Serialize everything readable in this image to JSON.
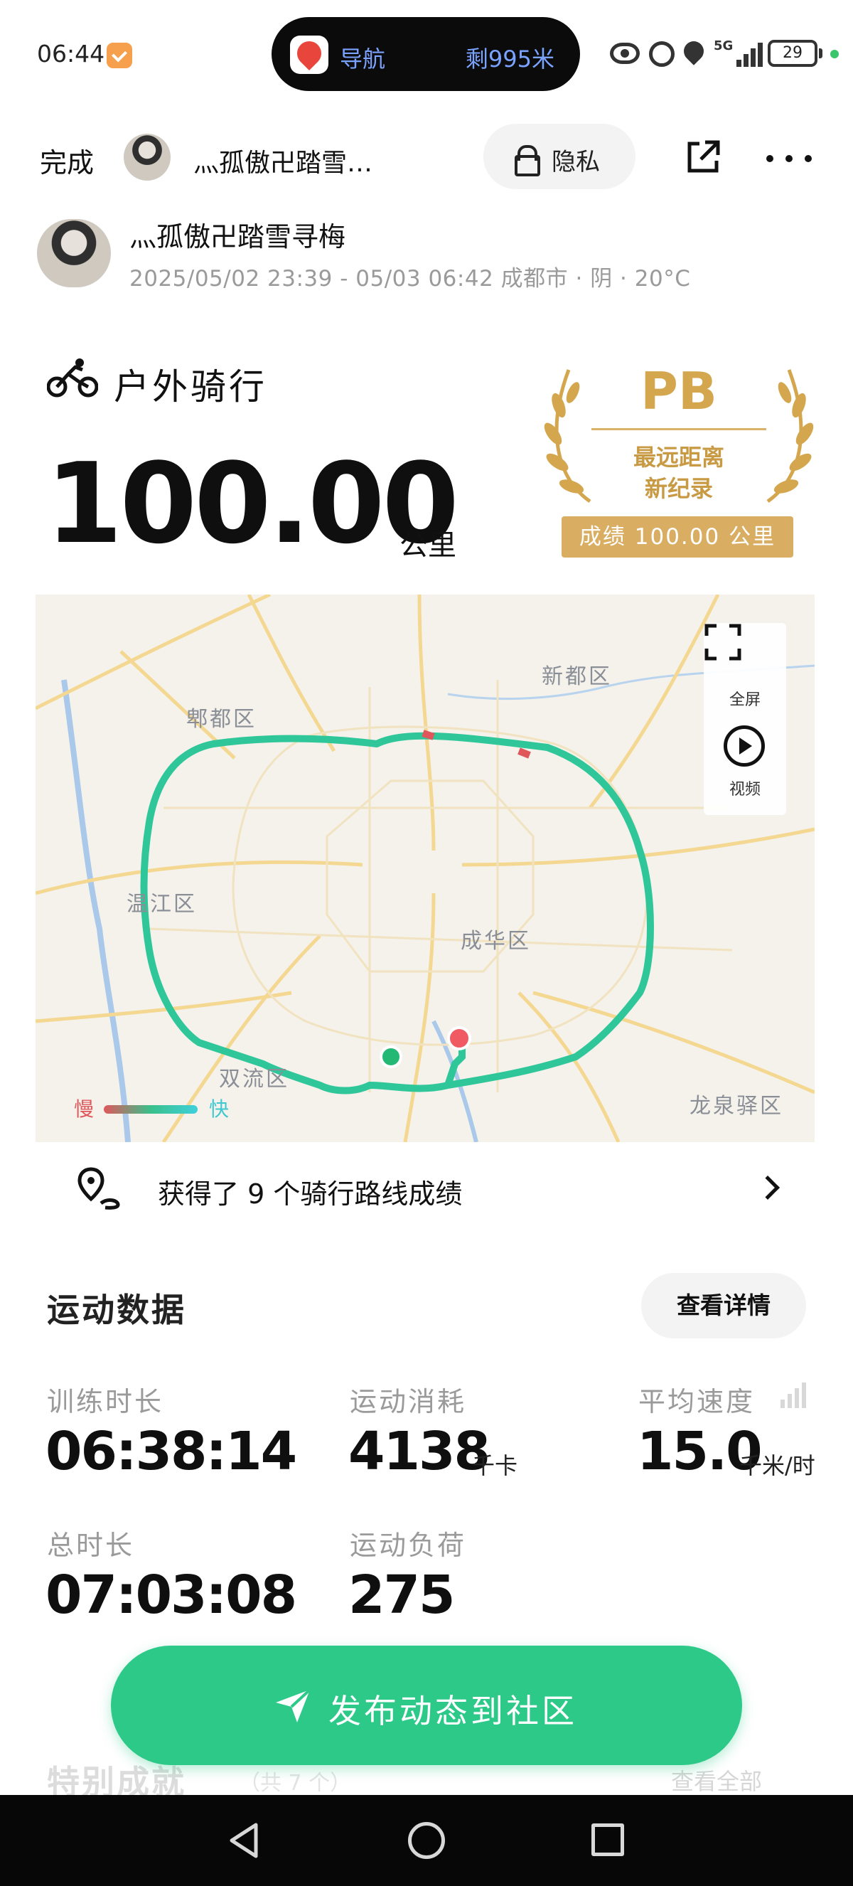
{
  "status_bar": {
    "time": "06:44",
    "nav_label": "导航",
    "nav_remaining": "剩995米",
    "network": "5G",
    "battery": "29"
  },
  "header": {
    "done_label": "完成",
    "username": "灬孤傲卍踏雪…",
    "privacy_label": "隐私",
    "icons": [
      "lock-icon",
      "share-icon",
      "more-icon"
    ]
  },
  "profile": {
    "name": "灬孤傲卍踏雪寻梅",
    "meta": "2025/05/02  23:39  -  05/03  06:42  成都市  ·  阴  ·  20°C"
  },
  "activity": {
    "type": "户外骑行",
    "distance": "100.00",
    "unit": "公里"
  },
  "pb_badge": {
    "title": "PB",
    "line1": "最远距离",
    "line2": "新纪录",
    "score": "成绩  100.00  公里",
    "color": "#d4a64e"
  },
  "map": {
    "labels": {
      "pidu": "郫都区",
      "xindu": "新都区",
      "wenjiang": "温江区",
      "chenghua": "成华区",
      "shuangliu": "双流区",
      "longquanyi": "龙泉驿区"
    },
    "fullscreen_label": "全屏",
    "video_label": "视频",
    "legend_slow": "慢",
    "legend_fast": "快",
    "route_color": "#2fc79a",
    "start_color": "#23b873",
    "end_color": "#ef5a63"
  },
  "route_achievements": {
    "text": "获得了  9  个骑行路线成绩"
  },
  "sport_data": {
    "title": "运动数据",
    "details_label": "查看详情",
    "metrics": [
      {
        "label": "训练时长",
        "value": "06:38:14",
        "unit": ""
      },
      {
        "label": "运动消耗",
        "value": "4138",
        "unit": "千卡"
      },
      {
        "label": "平均速度",
        "value": "15.0",
        "unit": "千米/时"
      },
      {
        "label": "总时长",
        "value": "07:03:08",
        "unit": ""
      },
      {
        "label": "运动负荷",
        "value": "275",
        "unit": ""
      }
    ]
  },
  "next_section": {
    "title": "特别成就",
    "subtitle": "（共 7 个）",
    "view_all": "查看全部"
  },
  "publish_button": {
    "label": "发布动态到社区",
    "color": "#2dc989"
  }
}
